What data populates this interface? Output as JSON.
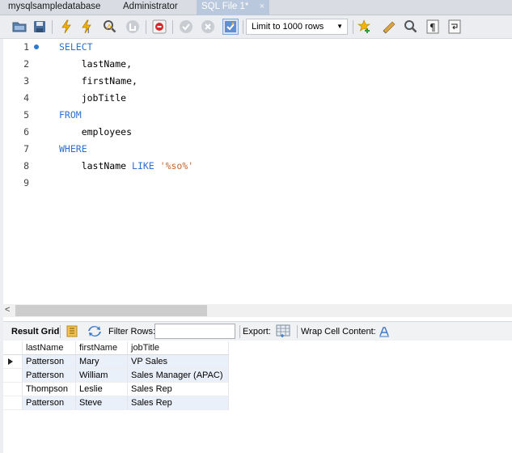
{
  "tabs": [
    {
      "label": "mysqlsampledatabase"
    },
    {
      "label": "Administrator"
    },
    {
      "label": "SQL File 1*",
      "close": "×"
    }
  ],
  "toolbar": {
    "limit_select": "Limit to 1000 rows",
    "icons": [
      "open-folder-icon",
      "save-icon",
      "execute-icon",
      "execute-current-icon",
      "explain-icon",
      "stop-icon",
      "toggle-error-icon",
      "commit-icon",
      "rollback-icon",
      "autocommit-icon",
      "bookmark-icon",
      "beautify-icon",
      "find-icon",
      "invisible-chars-icon",
      "wrap-icon"
    ]
  },
  "editor": {
    "lines": [
      {
        "n": "1",
        "tokens": [
          {
            "t": "SELECT",
            "k": "kw"
          }
        ]
      },
      {
        "n": "2",
        "tokens": [
          {
            "t": "    lastName,",
            "k": ""
          }
        ]
      },
      {
        "n": "3",
        "tokens": [
          {
            "t": "    firstName,",
            "k": ""
          }
        ]
      },
      {
        "n": "4",
        "tokens": [
          {
            "t": "    jobTitle",
            "k": ""
          }
        ]
      },
      {
        "n": "5",
        "tokens": [
          {
            "t": "FROM",
            "k": "kw"
          }
        ]
      },
      {
        "n": "6",
        "tokens": [
          {
            "t": "    employees",
            "k": ""
          }
        ]
      },
      {
        "n": "7",
        "tokens": [
          {
            "t": "WHERE",
            "k": "kw"
          }
        ]
      },
      {
        "n": "8",
        "tokens": [
          {
            "t": "    lastName ",
            "k": ""
          },
          {
            "t": "LIKE",
            "k": "kw"
          },
          {
            "t": " ",
            "k": ""
          },
          {
            "t": "'%so%'",
            "k": "str"
          }
        ]
      },
      {
        "n": "9",
        "tokens": []
      }
    ]
  },
  "scroll": {
    "left_arrow": "<"
  },
  "result_toolbar": {
    "result_grid": "Result Grid",
    "filter_rows": "Filter Rows:",
    "filter_value": "",
    "export": "Export:",
    "wrap_cell": "Wrap Cell Content:"
  },
  "grid": {
    "columns": [
      "lastName",
      "firstName",
      "jobTitle"
    ],
    "rows": [
      [
        "Patterson",
        "Mary",
        "VP Sales"
      ],
      [
        "Patterson",
        "William",
        "Sales Manager (APAC)"
      ],
      [
        "Thompson",
        "Leslie",
        "Sales Rep"
      ],
      [
        "Patterson",
        "Steve",
        "Sales Rep"
      ]
    ]
  },
  "colors": {
    "keyword": "#2f6fcf",
    "string": "#c2652d",
    "selected_tab": "#b9c8dc",
    "row_alt": "#eaf0f9"
  }
}
